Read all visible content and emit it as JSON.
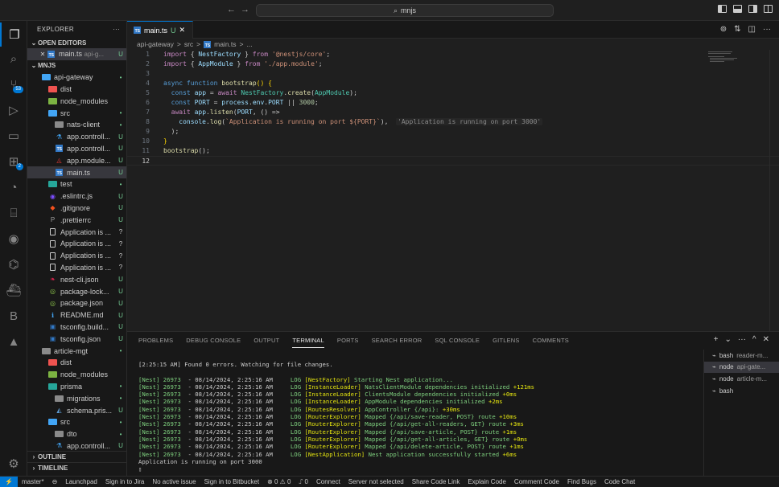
{
  "titlebar": {
    "nav_back": "←",
    "nav_forward": "→",
    "command_center": "mnjs"
  },
  "sidebar": {
    "title": "EXPLORER",
    "more": "···",
    "open_editors_label": "OPEN EDITORS",
    "open_editors": [
      {
        "name": "main.ts",
        "path": "api-g...",
        "status": "U"
      }
    ],
    "root_label": "MNJS",
    "tree": [
      {
        "indent": 1,
        "chev": "⌄",
        "icon": "folder-blue",
        "name": "api-gateway",
        "status": "•"
      },
      {
        "indent": 2,
        "chev": "›",
        "icon": "folder-red",
        "name": "dist",
        "status": ""
      },
      {
        "indent": 2,
        "chev": "›",
        "icon": "folder-green",
        "name": "node_modules",
        "status": ""
      },
      {
        "indent": 2,
        "chev": "⌄",
        "icon": "folder-blue",
        "name": "src",
        "status": "•"
      },
      {
        "indent": 3,
        "chev": "›",
        "icon": "folder",
        "name": "nats-client",
        "status": "•"
      },
      {
        "indent": 3,
        "chev": "",
        "icon": "flask",
        "name": "app.controll...",
        "status": "U"
      },
      {
        "indent": 3,
        "chev": "",
        "icon": "ts",
        "name": "app.controll...",
        "status": "U"
      },
      {
        "indent": 3,
        "chev": "",
        "icon": "angular",
        "name": "app.module...",
        "status": "U"
      },
      {
        "indent": 3,
        "chev": "",
        "icon": "ts",
        "name": "main.ts",
        "status": "U",
        "selected": true
      },
      {
        "indent": 2,
        "chev": "›",
        "icon": "folder-teal",
        "name": "test",
        "status": "•"
      },
      {
        "indent": 2,
        "chev": "",
        "icon": "eslint",
        "name": ".eslintrc.js",
        "status": "U"
      },
      {
        "indent": 2,
        "chev": "",
        "icon": "git",
        "name": ".gitignore",
        "status": "U"
      },
      {
        "indent": 2,
        "chev": "",
        "icon": "prettier",
        "name": ".prettierrc",
        "status": "U"
      },
      {
        "indent": 2,
        "chev": "",
        "icon": "file",
        "name": "Application is ...",
        "status": "?"
      },
      {
        "indent": 2,
        "chev": "",
        "icon": "file",
        "name": "Application is ...",
        "status": "?"
      },
      {
        "indent": 2,
        "chev": "",
        "icon": "file",
        "name": "Application is ...",
        "status": "?"
      },
      {
        "indent": 2,
        "chev": "",
        "icon": "file",
        "name": "Application is ...",
        "status": "?"
      },
      {
        "indent": 2,
        "chev": "",
        "icon": "nest",
        "name": "nest-cli.json",
        "status": "U"
      },
      {
        "indent": 2,
        "chev": "",
        "icon": "npm",
        "name": "package-lock...",
        "status": "U"
      },
      {
        "indent": 2,
        "chev": "",
        "icon": "npm",
        "name": "package.json",
        "status": "U"
      },
      {
        "indent": 2,
        "chev": "",
        "icon": "info",
        "name": "README.md",
        "status": "U"
      },
      {
        "indent": 2,
        "chev": "",
        "icon": "tsconfig",
        "name": "tsconfig.build...",
        "status": "U"
      },
      {
        "indent": 2,
        "chev": "",
        "icon": "tsconfig",
        "name": "tsconfig.json",
        "status": "U"
      },
      {
        "indent": 1,
        "chev": "⌄",
        "icon": "folder",
        "name": "article-mgt",
        "status": "•"
      },
      {
        "indent": 2,
        "chev": "›",
        "icon": "folder-red",
        "name": "dist",
        "status": ""
      },
      {
        "indent": 2,
        "chev": "›",
        "icon": "folder-green",
        "name": "node_modules",
        "status": ""
      },
      {
        "indent": 2,
        "chev": "⌄",
        "icon": "folder-teal",
        "name": "prisma",
        "status": "•"
      },
      {
        "indent": 3,
        "chev": "›",
        "icon": "folder",
        "name": "migrations",
        "status": "•"
      },
      {
        "indent": 3,
        "chev": "",
        "icon": "prisma",
        "name": "schema.pris...",
        "status": "U"
      },
      {
        "indent": 2,
        "chev": "⌄",
        "icon": "folder-blue",
        "name": "src",
        "status": "•"
      },
      {
        "indent": 3,
        "chev": "›",
        "icon": "folder",
        "name": "dto",
        "status": "•"
      },
      {
        "indent": 3,
        "chev": "",
        "icon": "flask",
        "name": "app.controll...",
        "status": "U"
      }
    ],
    "outline_label": "OUTLINE",
    "timeline_label": "TIMELINE"
  },
  "editor": {
    "tab_name": "main.ts",
    "tab_status": "U",
    "breadcrumb": [
      "api-gateway",
      ">",
      "src",
      ">",
      "main.ts",
      ">",
      "..."
    ],
    "code": [
      [
        [
          "kw",
          "import"
        ],
        [
          "pun",
          " { "
        ],
        [
          "id",
          "NestFactory"
        ],
        [
          "pun",
          " } "
        ],
        [
          "kw",
          "from"
        ],
        [
          "pun",
          " "
        ],
        [
          "str",
          "'@nestjs/core'"
        ],
        [
          "pun",
          ";"
        ]
      ],
      [
        [
          "kw",
          "import"
        ],
        [
          "pun",
          " { "
        ],
        [
          "id",
          "AppModule"
        ],
        [
          "pun",
          " } "
        ],
        [
          "kw",
          "from"
        ],
        [
          "pun",
          " "
        ],
        [
          "str",
          "'./app.module'"
        ],
        [
          "pun",
          ";"
        ]
      ],
      [],
      [
        [
          "kw2",
          "async"
        ],
        [
          "pun",
          " "
        ],
        [
          "kw2",
          "function"
        ],
        [
          "pun",
          " "
        ],
        [
          "fn",
          "bootstrap"
        ],
        [
          "br",
          "()"
        ],
        [
          "pun",
          " "
        ],
        [
          "br",
          "{"
        ]
      ],
      [
        [
          "pun",
          "  "
        ],
        [
          "kw2",
          "const"
        ],
        [
          "pun",
          " "
        ],
        [
          "id",
          "app"
        ],
        [
          "pun",
          " = "
        ],
        [
          "kw",
          "await"
        ],
        [
          "pun",
          " "
        ],
        [
          "ty",
          "NestFactory"
        ],
        [
          "pun",
          "."
        ],
        [
          "fn",
          "create"
        ],
        [
          "pun",
          "("
        ],
        [
          "ty",
          "AppModule"
        ],
        [
          "pun",
          ");"
        ]
      ],
      [
        [
          "pun",
          "  "
        ],
        [
          "kw2",
          "const"
        ],
        [
          "pun",
          " "
        ],
        [
          "id",
          "PORT"
        ],
        [
          "pun",
          " = "
        ],
        [
          "id",
          "process"
        ],
        [
          "pun",
          "."
        ],
        [
          "id",
          "env"
        ],
        [
          "pun",
          "."
        ],
        [
          "id",
          "PORT"
        ],
        [
          "pun",
          " || "
        ],
        [
          "num",
          "3000"
        ],
        [
          "pun",
          ";"
        ]
      ],
      [
        [
          "pun",
          "  "
        ],
        [
          "kw",
          "await"
        ],
        [
          "pun",
          " "
        ],
        [
          "id",
          "app"
        ],
        [
          "pun",
          "."
        ],
        [
          "fn",
          "listen"
        ],
        [
          "pun",
          "("
        ],
        [
          "id",
          "PORT"
        ],
        [
          "pun",
          ", () =>"
        ]
      ],
      [
        [
          "pun",
          "    "
        ],
        [
          "id",
          "console"
        ],
        [
          "pun",
          "."
        ],
        [
          "fn",
          "log"
        ],
        [
          "pun",
          "("
        ],
        [
          "str",
          "`Application is running on port ${PORT}`"
        ],
        [
          "pun",
          "),  "
        ],
        [
          "hint",
          "'Application is running on port 3000'"
        ]
      ],
      [
        [
          "pun",
          "  );"
        ]
      ],
      [
        [
          "br",
          "}"
        ]
      ],
      [
        [
          "fn",
          "bootstrap"
        ],
        [
          "pun",
          "();"
        ]
      ],
      []
    ],
    "current_line": 12
  },
  "panel": {
    "tabs": [
      "PROBLEMS",
      "DEBUG CONSOLE",
      "OUTPUT",
      "TERMINAL",
      "PORTS",
      "SEARCH ERROR",
      "SQL CONSOLE",
      "GITLENS",
      "COMMENTS"
    ],
    "active_tab": "TERMINAL",
    "actions": [
      "+",
      "⌄",
      "···",
      "^",
      "✕"
    ],
    "terminal_header": "[2:25:15 AM] Found 0 errors. Watching for file changes.",
    "log_lines": [
      {
        "pid": "[Nest] 26973",
        "date": "  - 08/14/2024, 2:25:16 AM",
        "level": "     LOG",
        "ctx": "[NestFactory]",
        "msg": " Starting Nest application...",
        "time": ""
      },
      {
        "pid": "[Nest] 26973",
        "date": "  - 08/14/2024, 2:25:16 AM",
        "level": "     LOG",
        "ctx": "[InstanceLoader]",
        "msg": " NatsClientModule dependencies initialized",
        "time": " +121ms"
      },
      {
        "pid": "[Nest] 26973",
        "date": "  - 08/14/2024, 2:25:16 AM",
        "level": "     LOG",
        "ctx": "[InstanceLoader]",
        "msg": " ClientsModule dependencies initialized",
        "time": " +0ms"
      },
      {
        "pid": "[Nest] 26973",
        "date": "  - 08/14/2024, 2:25:16 AM",
        "level": "     LOG",
        "ctx": "[InstanceLoader]",
        "msg": " AppModule dependencies initialized",
        "time": " +2ms"
      },
      {
        "pid": "[Nest] 26973",
        "date": "  - 08/14/2024, 2:25:16 AM",
        "level": "     LOG",
        "ctx": "[RoutesResolver]",
        "msg": " AppController {/api}:",
        "time": " +30ms"
      },
      {
        "pid": "[Nest] 26973",
        "date": "  - 08/14/2024, 2:25:16 AM",
        "level": "     LOG",
        "ctx": "[RouterExplorer]",
        "msg": " Mapped {/api/save-reader, POST} route",
        "time": " +10ms"
      },
      {
        "pid": "[Nest] 26973",
        "date": "  - 08/14/2024, 2:25:16 AM",
        "level": "     LOG",
        "ctx": "[RouterExplorer]",
        "msg": " Mapped {/api/get-all-readers, GET} route",
        "time": " +3ms"
      },
      {
        "pid": "[Nest] 26973",
        "date": "  - 08/14/2024, 2:25:16 AM",
        "level": "     LOG",
        "ctx": "[RouterExplorer]",
        "msg": " Mapped {/api/save-article, POST} route",
        "time": " +1ms"
      },
      {
        "pid": "[Nest] 26973",
        "date": "  - 08/14/2024, 2:25:16 AM",
        "level": "     LOG",
        "ctx": "[RouterExplorer]",
        "msg": " Mapped {/api/get-all-articles, GET} route",
        "time": " +0ms"
      },
      {
        "pid": "[Nest] 26973",
        "date": "  - 08/14/2024, 2:25:16 AM",
        "level": "     LOG",
        "ctx": "[RouterExplorer]",
        "msg": " Mapped {/api/delete-article, POST} route",
        "time": " +1ms"
      },
      {
        "pid": "[Nest] 26973",
        "date": "  - 08/14/2024, 2:25:16 AM",
        "level": "     LOG",
        "ctx": "[NestApplication]",
        "msg": " Nest application successfully started",
        "time": " +6ms"
      }
    ],
    "final_line": "Application is running on port 3000",
    "terminals": [
      {
        "name": "bash",
        "sub": "reader-m..."
      },
      {
        "name": "node",
        "sub": "api-gate...",
        "selected": true
      },
      {
        "name": "node",
        "sub": "article-m..."
      },
      {
        "name": "bash",
        "sub": ""
      }
    ]
  },
  "statusbar": {
    "items": [
      "master*",
      "⊖",
      "Launchpad",
      "Sign in to Jira",
      "No active issue",
      "Sign in to Bitbucket",
      "⊗ 0 ⚠ 0",
      "⑀ 0",
      "Connect",
      "Server not selected",
      "Share Code Link",
      "Explain Code",
      "Comment Code",
      "Find Bugs",
      "Code Chat"
    ]
  },
  "colors": {
    "accent": "#0078d4",
    "untracked": "#73c991"
  }
}
